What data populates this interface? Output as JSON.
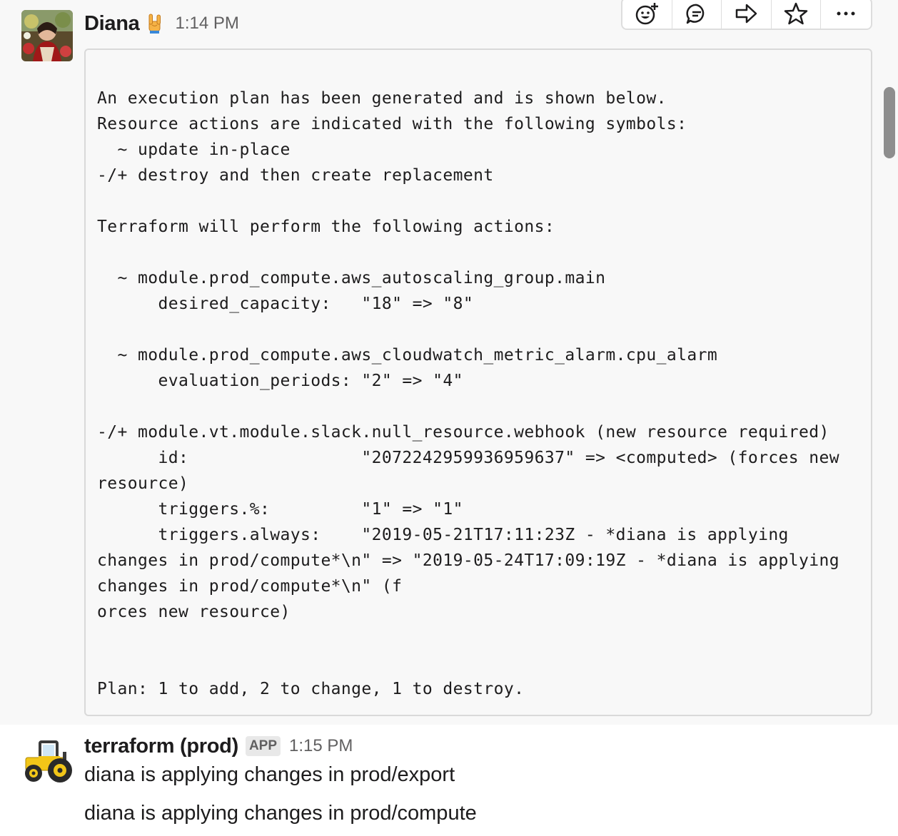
{
  "message1": {
    "sender": "Diana",
    "status_emoji": "sign-of-the-horns",
    "timestamp": "1:14 PM",
    "code_lines": [
      "",
      "An execution plan has been generated and is shown below.",
      "Resource actions are indicated with the following symbols:",
      "  ~ update in-place",
      "-/+ destroy and then create replacement",
      "",
      "Terraform will perform the following actions:",
      "",
      "  ~ module.prod_compute.aws_autoscaling_group.main",
      "      desired_capacity:   \"18\" => \"8\"",
      "",
      "  ~ module.prod_compute.aws_cloudwatch_metric_alarm.cpu_alarm",
      "      evaluation_periods: \"2\" => \"4\"",
      "",
      "-/+ module.vt.module.slack.null_resource.webhook (new resource required)",
      "      id:                 \"2072242959936959637\" => <computed> (forces new",
      "resource)",
      "      triggers.%:         \"1\" => \"1\"",
      "      triggers.always:    \"2019-05-21T17:11:23Z - *diana is applying",
      "changes in prod/compute*\\n\" => \"2019-05-24T17:09:19Z - *diana is applying",
      "changes in prod/compute*\\n\" (f",
      "orces new resource)",
      "",
      "",
      "Plan: 1 to add, 2 to change, 1 to destroy."
    ]
  },
  "toolbar": {
    "icons": [
      "add-reaction-icon",
      "reply-thread-icon",
      "share-icon",
      "star-icon",
      "more-actions-icon"
    ]
  },
  "message2": {
    "sender": "terraform (prod)",
    "badge": "APP",
    "timestamp": "1:15 PM",
    "lines": [
      "diana is applying changes in prod/export",
      "diana is applying changes in prod/compute"
    ]
  },
  "colors": {
    "hover_bg": "#f8f8f8",
    "text": "#1d1c1d",
    "muted": "#616061",
    "tractor_yellow": "#f2c618"
  }
}
